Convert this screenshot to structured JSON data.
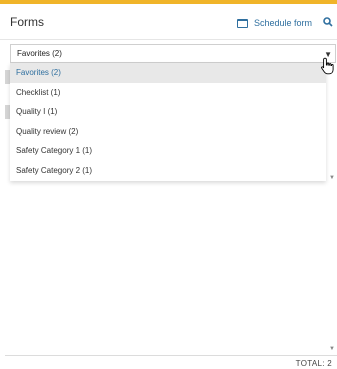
{
  "header": {
    "title": "Forms",
    "schedule_label": "Schedule form"
  },
  "dropdown": {
    "selected": "Favorites (2)",
    "options": [
      "Favorites (2)",
      "Checklist (1)",
      "Quality I (1)",
      "Quality review (2)",
      "Safety Category 1 (1)",
      "Safety Category 2 (1)"
    ]
  },
  "footer": {
    "total": "TOTAL: 2"
  },
  "colors": {
    "accent": "#f0b429",
    "link": "#2f6f9f",
    "selected_bg": "#e8e8e8"
  },
  "icons": {
    "schedule": "calendar-icon",
    "search": "search-icon",
    "dropdown": "caret-down-icon",
    "cursor": "hand-pointer-icon"
  }
}
